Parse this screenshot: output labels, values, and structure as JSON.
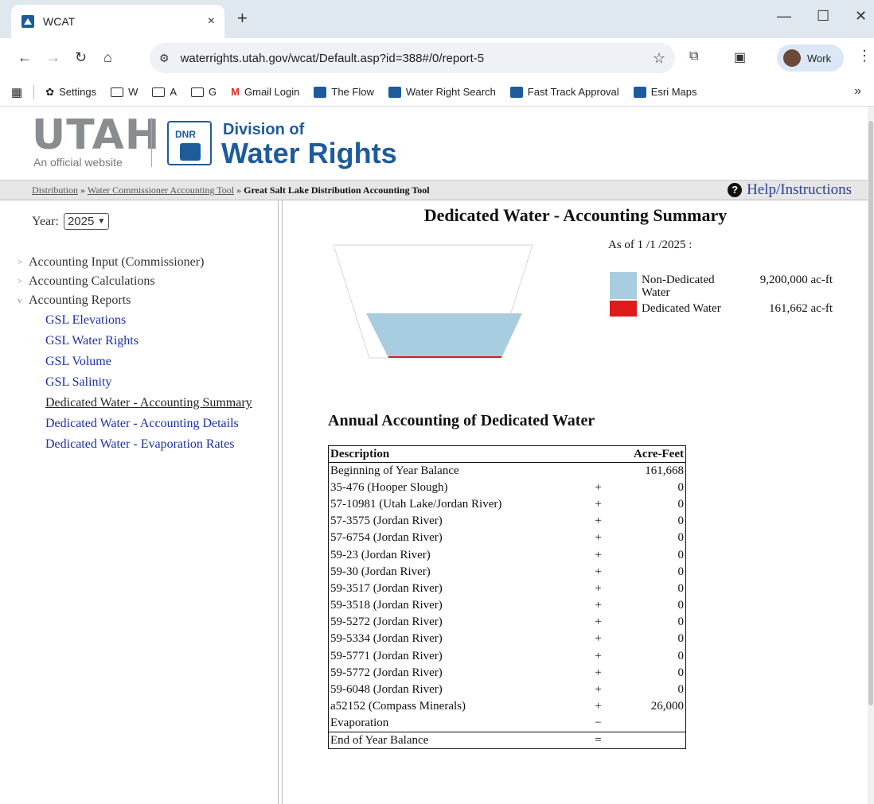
{
  "browser": {
    "tab_title": "WCAT",
    "tab_close": "×",
    "new_tab": "+",
    "url": "waterrights.utah.gov/wcat/Default.asp?id=388#/0/report-5",
    "profile_label": "Work",
    "bookmarks": [
      "Settings",
      "W",
      "A",
      "G",
      "Gmail Login",
      "The Flow",
      "Water Right Search",
      "Fast Track Approval",
      "Esri Maps"
    ],
    "more_label": "»"
  },
  "site": {
    "utah": "UTAH",
    "official": "An official website",
    "dnr": "DNR",
    "division": "Division of",
    "water_rights": "Water Rights"
  },
  "breadcrumb": {
    "items": [
      "Distribution",
      "Water Commissioner Accounting Tool"
    ],
    "separator": "»",
    "current": "Great Salt Lake Distribution Accounting Tool",
    "help": "Help/Instructions"
  },
  "sidebar": {
    "year_label": "Year:",
    "year_value": "2025",
    "groups": [
      {
        "label": "Accounting Input (Commissioner)",
        "caret": ">"
      },
      {
        "label": "Accounting Calculations",
        "caret": ">"
      },
      {
        "label": "Accounting Reports",
        "caret": "v"
      }
    ],
    "reports": [
      "GSL Elevations",
      "GSL Water Rights",
      "GSL Volume",
      "GSL Salinity",
      "Dedicated Water - Accounting Summary",
      "Dedicated Water - Accounting Details",
      "Dedicated Water - Evaporation Rates"
    ],
    "active_report_index": 4
  },
  "main": {
    "title": "Dedicated Water - Accounting Summary",
    "as_of": "As of 1 /1 /2025 :",
    "legend": [
      {
        "label": "Non-Dedicated Water",
        "value": "9,200,000 ac-ft",
        "color": "#a8cde0"
      },
      {
        "label": "Dedicated Water",
        "value": "161,662 ac-ft",
        "color": "#e01a1a"
      }
    ],
    "annual_title": "Annual Accounting of Dedicated Water",
    "table": {
      "headers": [
        "Description",
        "",
        "Acre-Feet"
      ],
      "rows": [
        [
          "Beginning of Year Balance",
          "",
          "161,668"
        ],
        [
          "35-476 (Hooper Slough)",
          "+",
          "0"
        ],
        [
          "57-10981 (Utah Lake/Jordan River)",
          "+",
          "0"
        ],
        [
          "57-3575 (Jordan River)",
          "+",
          "0"
        ],
        [
          "57-6754 (Jordan River)",
          "+",
          "0"
        ],
        [
          "59-23 (Jordan River)",
          "+",
          "0"
        ],
        [
          "59-30 (Jordan River)",
          "+",
          "0"
        ],
        [
          "59-3517 (Jordan River)",
          "+",
          "0"
        ],
        [
          "59-3518 (Jordan River)",
          "+",
          "0"
        ],
        [
          "59-5272 (Jordan River)",
          "+",
          "0"
        ],
        [
          "59-5334 (Jordan River)",
          "+",
          "0"
        ],
        [
          "59-5771 (Jordan River)",
          "+",
          "0"
        ],
        [
          "59-5772 (Jordan River)",
          "+",
          "0"
        ],
        [
          "59-6048 (Jordan River)",
          "+",
          "0"
        ],
        [
          "a52152 (Compass Minerals)",
          "+",
          "26,000"
        ],
        [
          "Evaporation",
          "−",
          ""
        ],
        [
          "End of Year Balance",
          "=",
          ""
        ]
      ]
    }
  }
}
